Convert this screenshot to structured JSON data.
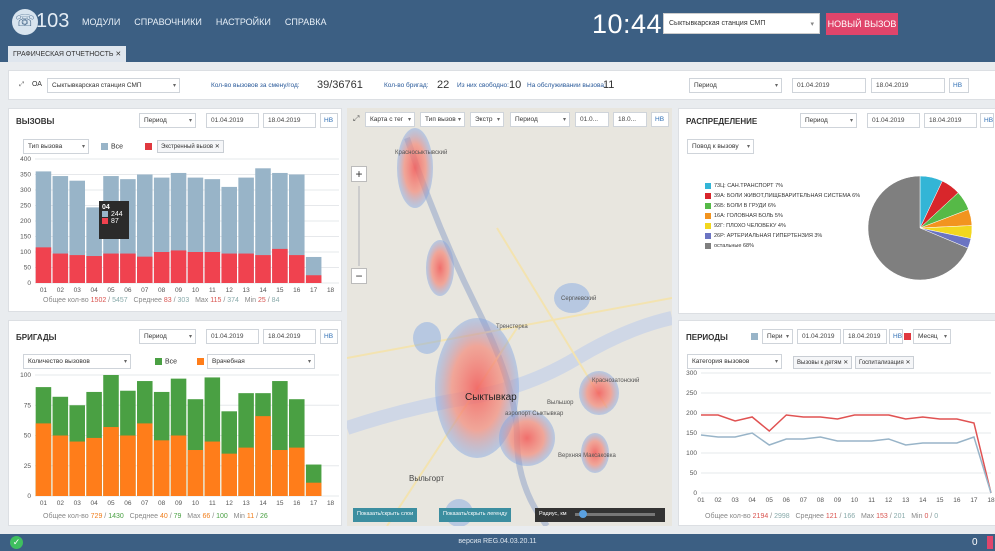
{
  "header": {
    "logo_text": "103",
    "menu": [
      "МОДУЛИ",
      "СПРАВОЧНИКИ",
      "НАСТРОЙКИ",
      "СПРАВКА"
    ],
    "clock": "10:44",
    "station": "Сыктывкарская станция СМП",
    "new_call": "НОВЫЙ ВЫЗОВ"
  },
  "tabs": {
    "active": "ГРАФИЧЕСКАЯ ОТЧЕТНОСТЬ"
  },
  "filters": {
    "oa": "ОА",
    "station": "Сыктывкарская станция СМП",
    "calls_label": "Кол-во вызовов за смену/год:",
    "calls_value": "39/36761",
    "brigades_label": "Кол-во бригад:",
    "brigades_value": "22",
    "free_label": "Из них свободно:",
    "free_value": "10",
    "serving_label": "На обслуживании вызова:",
    "serving_value": "11",
    "period": "Период",
    "date_from": "01.04.2019",
    "date_to": "18.04.2019",
    "nb": "НВ"
  },
  "calls": {
    "title": "ВЫЗОВЫ",
    "period": "Период",
    "date_from": "01.04.2019",
    "date_to": "18.04.2019",
    "nb": "НВ",
    "type_select": "Тип вызова",
    "legend_all": "Все",
    "legend_emergency_chip": "Экстренный вызов",
    "tooltip": {
      "day": "04",
      "all": "244",
      "emergency": "87"
    },
    "stats": {
      "total_label": "Общее кол-во",
      "total": "1502",
      "total_all": "5457",
      "avg_label": "Среднее",
      "avg": "83",
      "avg_all": "303",
      "max_label": "Max",
      "max": "115",
      "max_all": "374",
      "min_label": "Min",
      "min": "25",
      "min_all": "84"
    }
  },
  "brigades": {
    "title": "БРИГАДЫ",
    "period": "Период",
    "date_from": "01.04.2019",
    "date_to": "18.04.2019",
    "nb": "НВ",
    "metric_select": "Количество вызовов",
    "legend_all": "Все",
    "type_select": "Врачебная",
    "stats": {
      "total_label": "Общее кол-во",
      "total": "729",
      "total_all": "1430",
      "avg_label": "Среднее",
      "avg": "40",
      "avg_all": "79",
      "max_label": "Max",
      "max": "66",
      "max_all": "100",
      "min_label": "Min",
      "min": "11",
      "min_all": "26"
    }
  },
  "map": {
    "map_select": "Карта с тег",
    "call_type": "Тип вызов",
    "emergency": "Экстр",
    "period": "Период",
    "date_from": "01.0...",
    "date_to": "18.0...",
    "nb": "НВ",
    "labels": {
      "city": "Сыктывкар",
      "north": "Краснозатонский",
      "serg": "Сергиевский",
      "trek": "Тренстерка",
      "vylgort": "Выльгорт",
      "verkh": "Верхняя Максаковка",
      "kras2": "Красносыктывский",
      "vylshor": "Выльшор",
      "airport": "аэропорт Сыктывкар"
    },
    "btn_layers": "Показать/скрыть слои",
    "btn_legend": "Показать/скрыть легенду",
    "radius_label": "Радиус, км"
  },
  "distribution": {
    "title": "РАСПРЕДЕЛЕНИЕ",
    "period": "Период",
    "date_from": "01.04.2019",
    "date_to": "18.04.2019",
    "nb": "НВ",
    "reason_select": "Повод к вызову",
    "legend": [
      {
        "label": "73Ц: САН.ТРАНСПОРТ",
        "pct": "7%",
        "color": "#33b5d6"
      },
      {
        "label": "39А: БОЛИ ЖИВОТ,ПИЩЕВАРИТЕЛЬНАЯ СИСТЕМА",
        "pct": "6%",
        "color": "#d8262b"
      },
      {
        "label": "26Б: БОЛИ В ГРУДИ",
        "pct": "6%",
        "color": "#56b947"
      },
      {
        "label": "16А: ГОЛОВНАЯ БОЛЬ",
        "pct": "5%",
        "color": "#f2941f"
      },
      {
        "label": "92Г: ПЛОХО ЧЕЛОВЕКУ",
        "pct": "4%",
        "color": "#f2d71f"
      },
      {
        "label": "26Р: АРТЕРИАЛЬНАЯ ГИПЕРТЕНЗИЯ",
        "pct": "3%",
        "color": "#6b74c2"
      },
      {
        "label": "остальные",
        "pct": "68%",
        "color": "#7f7f7f"
      }
    ]
  },
  "periods": {
    "title": "ПЕРИОДЫ",
    "series_select": "Пери",
    "date_from": "01.04.2019",
    "date_to": "18.04.2019",
    "nb": "НВ",
    "month_select": "Месяц",
    "category_select": "Категория вызовов",
    "chip1": "Вызовы к детям",
    "chip2": "Госпитализация",
    "stats": {
      "total_label": "Общее кол-во",
      "total": "2194",
      "total_all": "2998",
      "avg_label": "Среднее",
      "avg": "121",
      "avg_all": "166",
      "max_label": "Max",
      "max": "153",
      "max_all": "201",
      "min_label": "Min",
      "min": "0",
      "min_all": "0"
    }
  },
  "footer": {
    "version": "версия REG.04.03.20.11",
    "count": "0"
  },
  "chart_data": [
    {
      "type": "bar",
      "name": "ВЫЗОВЫ",
      "categories": [
        "01",
        "02",
        "03",
        "04",
        "05",
        "06",
        "07",
        "08",
        "09",
        "10",
        "11",
        "12",
        "13",
        "14",
        "15",
        "16",
        "17"
      ],
      "ylim": [
        0,
        400
      ],
      "yticks": [
        0,
        50,
        100,
        150,
        200,
        250,
        300,
        350,
        400
      ],
      "series": [
        {
          "name": "Все",
          "color": "#98b4c8",
          "values": [
            360,
            345,
            330,
            244,
            345,
            335,
            350,
            340,
            355,
            340,
            335,
            310,
            340,
            370,
            355,
            350,
            84
          ]
        },
        {
          "name": "Экстренный вызов",
          "color": "#f0424f",
          "values": [
            115,
            95,
            90,
            87,
            95,
            95,
            85,
            100,
            105,
            100,
            100,
            95,
            95,
            90,
            110,
            90,
            25
          ]
        }
      ]
    },
    {
      "type": "bar",
      "name": "БРИГАДЫ",
      "categories": [
        "01",
        "02",
        "03",
        "04",
        "05",
        "06",
        "07",
        "08",
        "09",
        "10",
        "11",
        "12",
        "13",
        "14",
        "15",
        "16",
        "17"
      ],
      "ylim": [
        0,
        100
      ],
      "yticks": [
        0,
        25,
        50,
        75,
        100
      ],
      "series": [
        {
          "name": "Все",
          "color": "#4aa043",
          "values": [
            90,
            82,
            75,
            86,
            100,
            87,
            95,
            86,
            97,
            80,
            98,
            70,
            85,
            85,
            95,
            80,
            26
          ]
        },
        {
          "name": "Врачебная",
          "color": "#ff7d1a",
          "values": [
            60,
            50,
            45,
            48,
            57,
            50,
            60,
            46,
            50,
            38,
            45,
            35,
            40,
            66,
            38,
            40,
            11
          ]
        }
      ]
    },
    {
      "type": "pie",
      "name": "РАСПРЕДЕЛЕНИЕ",
      "labels": [
        "73Ц: САН.ТРАНСПОРТ",
        "39А: БОЛИ ЖИВОТ,ПИЩЕВАРИТЕЛЬНАЯ СИСТЕМА",
        "26Б: БОЛИ В ГРУДИ",
        "16А: ГОЛОВНАЯ БОЛЬ",
        "92Г: ПЛОХО ЧЕЛОВЕКУ",
        "26Р: АРТЕРИАЛЬНАЯ ГИПЕРТЕНЗИЯ",
        "остальные"
      ],
      "values": [
        7,
        6,
        6,
        5,
        4,
        3,
        68
      ],
      "colors": [
        "#33b5d6",
        "#d8262b",
        "#56b947",
        "#f2941f",
        "#f2d71f",
        "#6b74c2",
        "#7f7f7f"
      ]
    },
    {
      "type": "line",
      "name": "ПЕРИОДЫ",
      "x": [
        "01",
        "02",
        "03",
        "04",
        "05",
        "06",
        "07",
        "08",
        "09",
        "10",
        "11",
        "12",
        "13",
        "14",
        "15",
        "16",
        "17",
        "18"
      ],
      "ylim": [
        0,
        300
      ],
      "yticks": [
        0,
        50,
        100,
        150,
        200,
        250,
        300
      ],
      "series": [
        {
          "color": "#e05252",
          "values": [
            195,
            195,
            180,
            190,
            155,
            195,
            190,
            190,
            185,
            195,
            195,
            195,
            185,
            190,
            185,
            185,
            175,
            0
          ]
        },
        {
          "color": "#98b4c8",
          "values": [
            145,
            140,
            140,
            150,
            120,
            135,
            135,
            140,
            130,
            130,
            130,
            135,
            120,
            125,
            125,
            125,
            140,
            0
          ]
        }
      ]
    }
  ]
}
